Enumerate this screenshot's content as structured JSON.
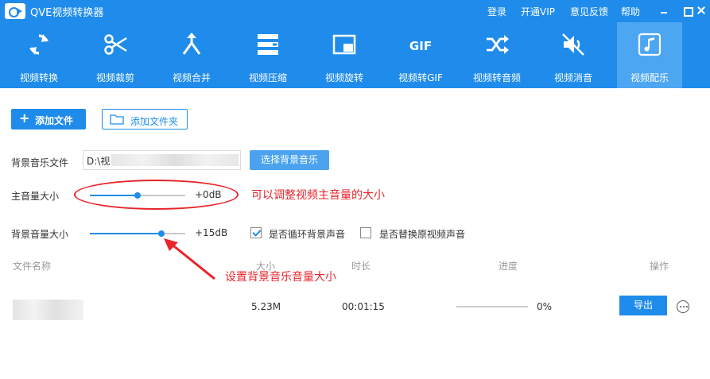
{
  "app": {
    "title": "QVE视频转换器"
  },
  "titlebar": {
    "links": [
      "登录",
      "开通VIP",
      "意见反馈",
      "帮助"
    ]
  },
  "toolbar": {
    "active_index": 8,
    "tools": [
      {
        "label": "视频转换",
        "icon": "convert-icon"
      },
      {
        "label": "视频裁剪",
        "icon": "scissors-icon"
      },
      {
        "label": "视频合并",
        "icon": "merge-icon"
      },
      {
        "label": "视频压缩",
        "icon": "compress-icon"
      },
      {
        "label": "视频旋转",
        "icon": "rotate-icon"
      },
      {
        "label": "视频转GIF",
        "icon": "gif-icon"
      },
      {
        "label": "视频转音频",
        "icon": "shuffle-icon"
      },
      {
        "label": "视频消音",
        "icon": "mute-icon"
      },
      {
        "label": "视频配乐",
        "icon": "music-note-icon"
      }
    ]
  },
  "actions": {
    "add_file": "添加文件",
    "add_folder": "添加文件夹"
  },
  "form": {
    "bg_music_label": "背景音乐文件",
    "bg_music_path": "D:\\视",
    "select_music_button": "选择背景音乐",
    "main_volume_label": "主音量大小",
    "main_volume_value": "+0dB",
    "main_volume_level": 0.5,
    "bg_volume_label": "背景音量大小",
    "bg_volume_value": "+15dB",
    "bg_volume_level": 0.75,
    "loop_label": "是否循环背景声音",
    "loop_checked": true,
    "replace_label": "是否替换原视频声音",
    "replace_checked": false
  },
  "annotations": {
    "main_volume_note": "可以调整视频主音量的大小",
    "bg_volume_note": "设置背景音乐音量大小",
    "color": "#e8252b"
  },
  "table": {
    "headers": {
      "filename": "文件名称",
      "size": "大小",
      "duration": "时长",
      "progress": "进度",
      "actions": "操作"
    },
    "rows": [
      {
        "size": "5.23M",
        "duration": "00:01:15",
        "progress": "0%",
        "progress_level": 0,
        "export_label": "导出"
      }
    ]
  },
  "colors": {
    "accent": "#1f8ceb",
    "active_tab": "#4da6f2"
  }
}
